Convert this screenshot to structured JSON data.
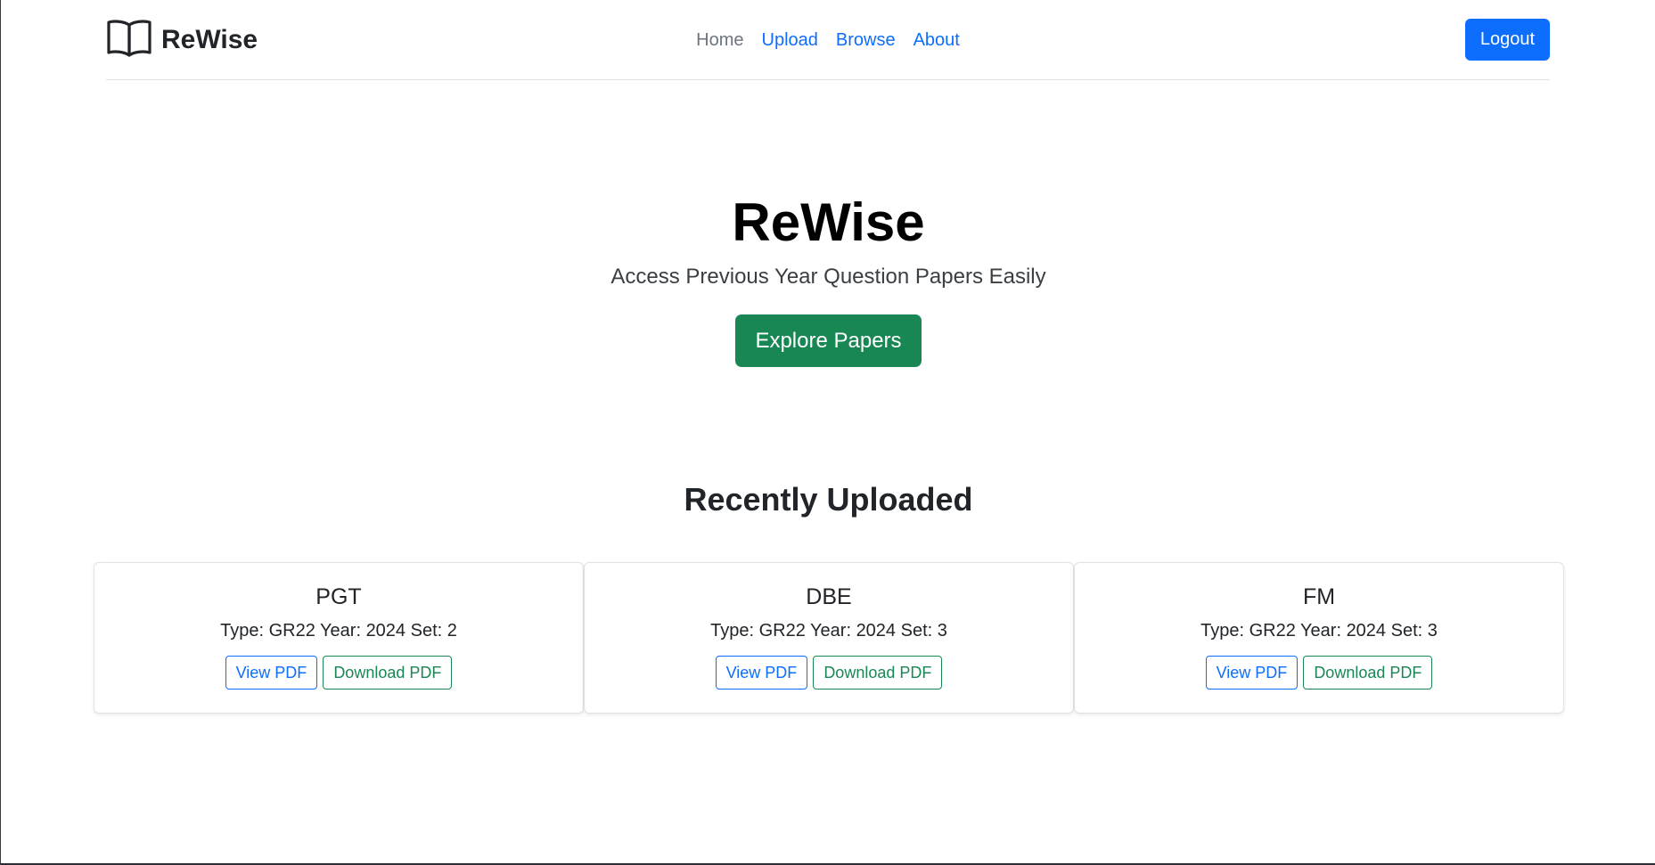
{
  "header": {
    "brand": "ReWise",
    "brand_icon": "open-book-icon",
    "nav": [
      {
        "label": "Home",
        "active": true
      },
      {
        "label": "Upload",
        "active": false
      },
      {
        "label": "Browse",
        "active": false
      },
      {
        "label": "About",
        "active": false
      }
    ],
    "logout_label": "Logout"
  },
  "hero": {
    "title": "ReWise",
    "subtitle": "Access Previous Year Question Papers Easily",
    "cta_label": "Explore Papers"
  },
  "recent": {
    "title": "Recently Uploaded",
    "cards": [
      {
        "title": "PGT",
        "meta": "Type: GR22 Year: 2024 Set: 2",
        "view_label": "View PDF",
        "download_label": "Download PDF"
      },
      {
        "title": "DBE",
        "meta": "Type: GR22 Year: 2024 Set: 3",
        "view_label": "View PDF",
        "download_label": "Download PDF"
      },
      {
        "title": "FM",
        "meta": "Type: GR22 Year: 2024 Set: 3",
        "view_label": "View PDF",
        "download_label": "Download PDF"
      }
    ]
  },
  "colors": {
    "primary": "#0d6efd",
    "success": "#198754",
    "muted": "#6c757d"
  }
}
